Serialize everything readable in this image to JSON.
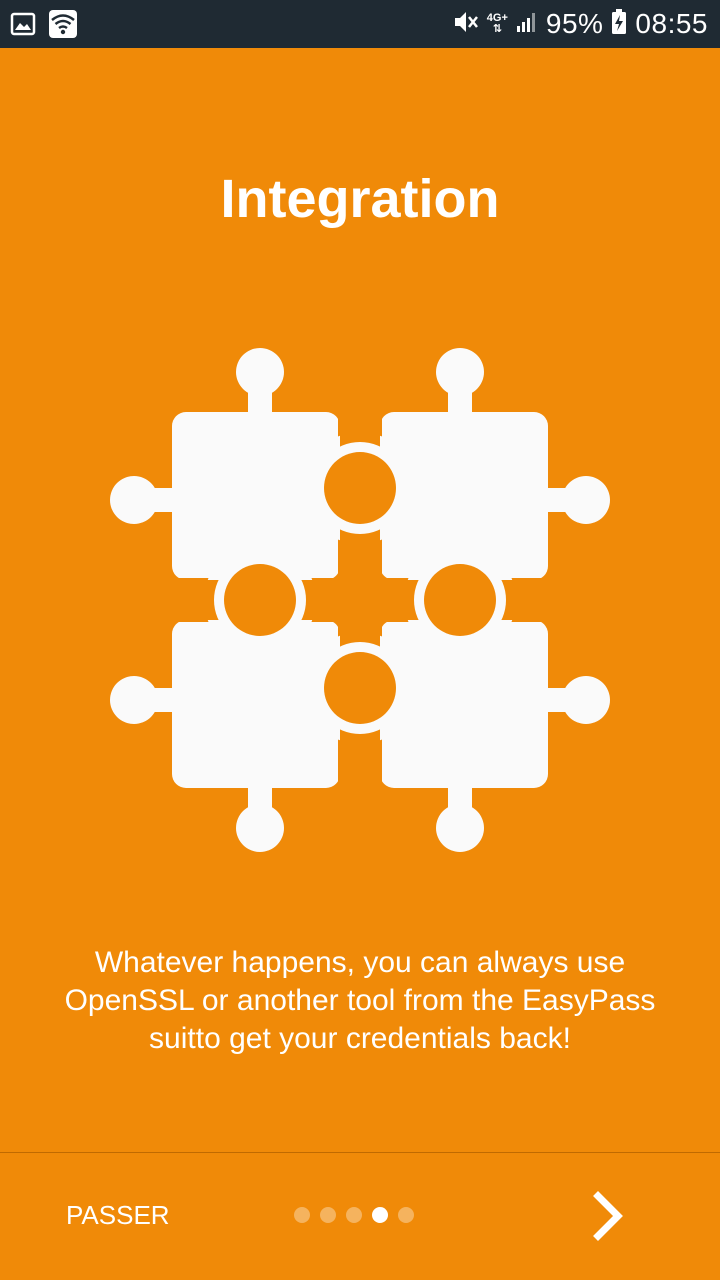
{
  "status_bar": {
    "network_type": "4G+",
    "battery_percent": "95%",
    "time": "08:55",
    "icons": [
      "image-icon",
      "wifi-icon",
      "mute-icon",
      "signal-icon",
      "battery-charging-icon"
    ]
  },
  "onboarding": {
    "title": "Integration",
    "illustration": "puzzle-pieces-icon",
    "description_lines": [
      "Whatever happens, you can always use",
      "OpenSSL or another tool from the EasyPass",
      "suitto get your credentials back!"
    ]
  },
  "footer": {
    "skip_label": "PASSER",
    "page_count": 5,
    "active_page": 4,
    "next_icon": "chevron-right-icon"
  },
  "colors": {
    "background": "#F08A08",
    "status_bar": "#1F2A33",
    "foreground": "#FFFFFF"
  }
}
